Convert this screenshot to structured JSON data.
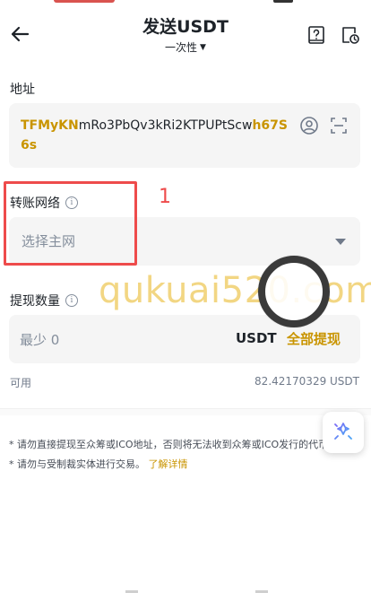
{
  "header": {
    "title": "发送USDT",
    "subtitle": "一次性"
  },
  "address": {
    "label": "地址",
    "value_prefix": "TFMyKN",
    "value_middle": "mRo3PbQv3kRi2KTPUPtScw",
    "value_suffix": "h67S6s"
  },
  "network": {
    "label": "转账网络",
    "placeholder": "选择主网"
  },
  "amount": {
    "label": "提现数量",
    "placeholder": "最少 0",
    "unit": "USDT",
    "max_label": "全部提现"
  },
  "available": {
    "label": "可用",
    "value": "82.42170329 USDT"
  },
  "notes": {
    "note1": "* 请勿直接提现至众筹或ICO地址，否则将无法收到众筹或ICO发行的代币。",
    "note2": "* 请勿与受制裁实体进行交易。",
    "note2_link": "了解详情"
  },
  "annotation": {
    "number": "1"
  },
  "watermark": {
    "text": "qukuai520.com"
  },
  "colors": {
    "accent": "#c99400",
    "annotation": "#ee4b4b",
    "field_bg": "#f5f5f5"
  },
  "icons": [
    "back-arrow-icon",
    "faq-icon",
    "history-icon",
    "contact-icon",
    "scan-icon",
    "info-icon",
    "dropdown-caret-icon",
    "assistant-icon"
  ]
}
